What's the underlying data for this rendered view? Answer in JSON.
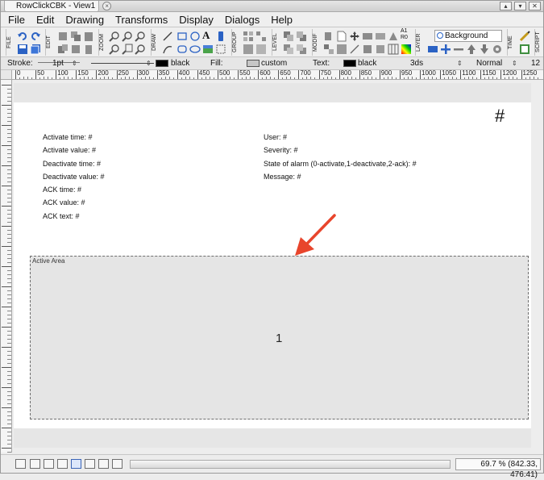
{
  "window": {
    "tab_title": "RowClickCBK - View1"
  },
  "menu": [
    "File",
    "Edit",
    "Drawing",
    "Transforms",
    "Display",
    "Dialogs",
    "Help"
  ],
  "toolbar": {
    "groups": [
      "FILE",
      "EDIT",
      "ZOOM",
      "DRAW",
      "GROUP",
      "LEVEL",
      "MODIF",
      "LAYER",
      "TIME",
      "SCRIPT"
    ],
    "layer_name": "Background",
    "a1_label": "A1",
    "r0_label": "R0",
    "text_tool": "A"
  },
  "properties": {
    "stroke_label": "Stroke:",
    "stroke_width": "1pt",
    "stroke_color": "black",
    "fill_label": "Fill:",
    "fill_color": "custom",
    "text_label": "Text:",
    "text_color": "black",
    "text_style": "3ds",
    "blend_mode": "Normal",
    "font_size": "12"
  },
  "colors": {
    "stroke_swatch": "#000000",
    "fill_swatch": "#c6c6c6",
    "text_swatch": "#000000",
    "arrow": "#e8452c"
  },
  "ruler_labels": [
    "0",
    "50",
    "100",
    "150",
    "200",
    "250",
    "300",
    "350",
    "400",
    "450",
    "500",
    "550",
    "600",
    "650",
    "700",
    "750",
    "800",
    "850",
    "900",
    "950",
    "1000",
    "1050",
    "1100",
    "1150",
    "1200",
    "1250"
  ],
  "canvas": {
    "left_fields": [
      "Activate time: #",
      "Activate value: #",
      "Deactivate time: #",
      "Deactivate value: #",
      "ACK time: #",
      "ACK value: #",
      "ACK text: #"
    ],
    "right_fields": [
      "User: #",
      "Severity: #",
      "State of alarm (0-activate,1-deactivate,2-ack): #",
      "Message: #"
    ],
    "corner_mark": "#",
    "active_area_label": "Active Area",
    "active_area_value": "1"
  },
  "status": {
    "zoom_coords": "69.7 % (842.33, 476.41)"
  }
}
